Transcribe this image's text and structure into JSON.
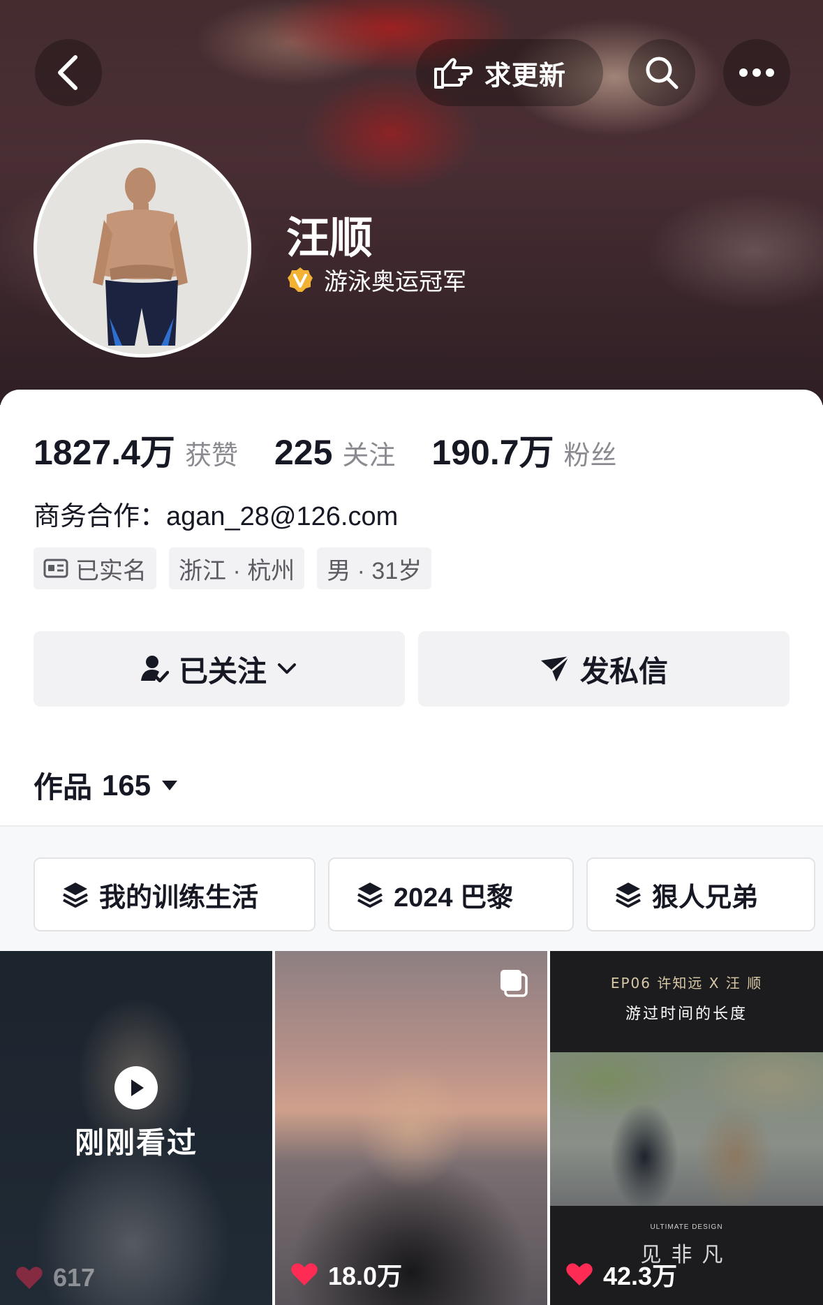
{
  "header": {
    "update_label": "求更新",
    "nickname": "汪顺",
    "verification": "游泳奥运冠军"
  },
  "stats": [
    {
      "value": "1827.4万",
      "label": "获赞"
    },
    {
      "value": "225",
      "label": "关注"
    },
    {
      "value": "190.7万",
      "label": "粉丝"
    }
  ],
  "contact": "商务合作：agan_28@126.com",
  "tags": {
    "realname": "已实名",
    "location": "浙江 · 杭州",
    "gender_age": "男 · 31岁"
  },
  "actions": {
    "follow_label": "已关注",
    "message_label": "发私信"
  },
  "works": {
    "label": "作品",
    "count": "165"
  },
  "collections": [
    {
      "label": "我的训练生活"
    },
    {
      "label": "2024 巴黎"
    },
    {
      "label": "狠人兄弟"
    }
  ],
  "videos": [
    {
      "likes": "617",
      "overlay": "刚刚看过"
    },
    {
      "likes": "18.0万"
    },
    {
      "likes": "42.3万",
      "ep_line": "EP06  许知远  X  汪 顺",
      "ep_title": "游过时间的长度",
      "brand": "ULTIMATE DESIGN",
      "big_title": "见非凡"
    }
  ],
  "colors": {
    "heart": "#fe2c55",
    "verify_badge": "#f2b233",
    "button_bg": "#f2f2f4",
    "muted_text": "#8a8b91"
  }
}
